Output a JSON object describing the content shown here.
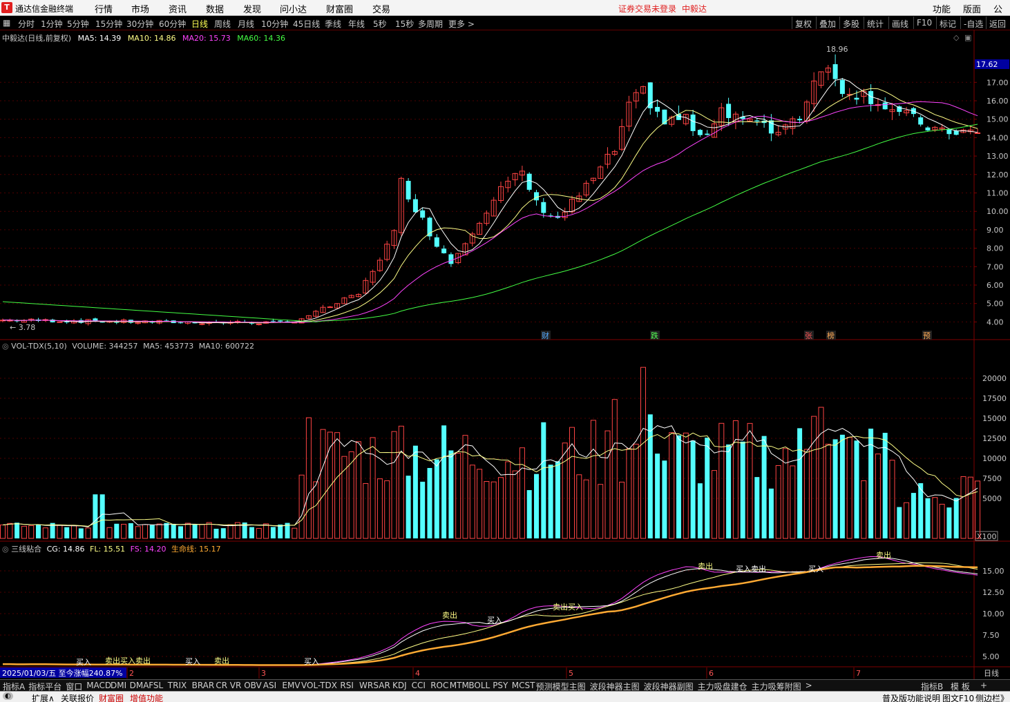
{
  "menubar": {
    "app_title": "通达信金融终端",
    "items": [
      "行情",
      "市场",
      "资讯",
      "数据",
      "发现",
      "问小达",
      "财富圈",
      "交易"
    ],
    "status_login": "证券交易未登录",
    "status_stock": "中毅达",
    "right_items": [
      "功能",
      "版面",
      "公式"
    ]
  },
  "periodbar": {
    "items": [
      "分时",
      "1分钟",
      "5分钟",
      "15分钟",
      "30分钟",
      "60分钟",
      "日线",
      "周线",
      "月线",
      "10分钟",
      "45日线",
      "季线",
      "年线",
      "5秒",
      "15秒",
      "多周期",
      "更多 >"
    ],
    "active": "日线",
    "right_buttons": [
      "复权",
      "叠加",
      "多股",
      "统计",
      "画线",
      "F10",
      "标记",
      "-自选",
      "返回"
    ]
  },
  "main_pane": {
    "title": "中毅达(日线,前复权)",
    "ma5": "MA5: 14.39",
    "ma10": "MA10: 14.86",
    "ma20": "MA20: 15.73",
    "ma60": "MA60: 14.36",
    "price_axis": [
      "17.00",
      "16.00",
      "15.00",
      "14.00",
      "13.00",
      "12.00",
      "11.00",
      "10.00",
      "9.00",
      "8.00",
      "7.00",
      "6.00",
      "5.00",
      "4.00"
    ],
    "current_price": "17.62",
    "high_label": "18.96",
    "low_label": "3.78",
    "markers": [
      {
        "text": "财",
        "color": "#55aaff"
      },
      {
        "text": "跌",
        "color": "#55ff55"
      },
      {
        "text": "张",
        "color": "#ff5555"
      },
      {
        "text": "榜",
        "color": "#ffaa55"
      },
      {
        "text": "预",
        "color": "#ffaa55"
      }
    ],
    "colors": {
      "up": "#ff4444",
      "down": "#54ffff",
      "ma5": "#ffffff",
      "ma10": "#ffff88",
      "ma20": "#ff44ff",
      "ma60": "#44ff44"
    }
  },
  "volume_pane": {
    "title": "VOL-TDX(5,10)",
    "volume": "VOLUME: 344257",
    "ma5": "MA5: 453773",
    "ma10": "MA10: 600722",
    "axis": [
      "20000",
      "17500",
      "15000",
      "12500",
      "10000",
      "7500",
      "5000"
    ],
    "unit": "X100"
  },
  "indicator_pane": {
    "title": "三线粘合",
    "cg": "CG: 14.86",
    "fl": "FL: 15.51",
    "fs": "FS: 14.20",
    "life": "生命线: 15.17",
    "axis": [
      "15.00",
      "12.50",
      "10.00",
      "7.50",
      "5.00"
    ],
    "signals": [
      "买入",
      "卖出买入卖出",
      "买入",
      "卖出",
      "买入",
      "卖出",
      "买入",
      "卖出买入",
      "卖出",
      "买入卖出",
      "买入",
      "卖出"
    ]
  },
  "time_axis": {
    "date_info": "2025/01/03/五 至今涨幅240.87%",
    "months": [
      "2",
      "3",
      "4",
      "5",
      "6",
      "7"
    ],
    "period": "日线"
  },
  "bottom_tabs": {
    "items": [
      "指标A",
      "指标平台",
      "窗口",
      "MACD",
      "DMI",
      "DMA",
      "FSL",
      "TRIX",
      "BRAR",
      "CR",
      "VR",
      "OBV",
      "ASI",
      "EMV",
      "VOL-TDX",
      "RSI",
      "WR",
      "SAR",
      "KDJ",
      "CCI",
      "ROC",
      "MTM",
      "BOLL",
      "PSY",
      "MCST",
      "预测模型主图",
      "波段神器主图",
      "波段神器副图",
      "主力吸盘建仓",
      "主力吸筹附图",
      ">"
    ],
    "right": [
      "指标B",
      "模 板",
      "+"
    ]
  },
  "statusbar": {
    "left_items": [
      "扩展∧",
      "关联报价",
      "财富圈",
      "增值功能"
    ],
    "right_items": [
      "普及版功能说明",
      "图文F10",
      "侧边栏》"
    ]
  }
}
